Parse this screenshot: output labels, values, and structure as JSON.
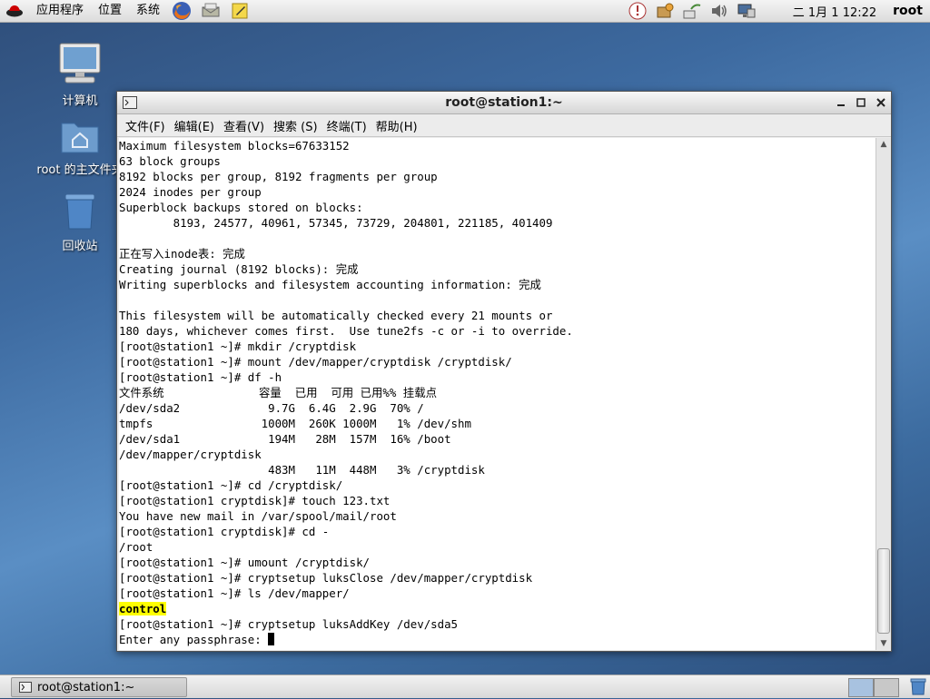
{
  "top_panel": {
    "menus": [
      "应用程序",
      "位置",
      "系统"
    ],
    "clock": "二 1月  1 12:22",
    "user": "root"
  },
  "desktop": {
    "icons": [
      {
        "label": "计算机",
        "icon": "computer-icon"
      },
      {
        "label": "root 的主文件夹",
        "icon": "home-folder-icon"
      },
      {
        "label": "回收站",
        "icon": "trash-icon"
      }
    ]
  },
  "window": {
    "title": "root@station1:~",
    "menus": [
      "文件(F)",
      "编辑(E)",
      "查看(V)",
      "搜索 (S)",
      "终端(T)",
      "帮助(H)"
    ],
    "terminal": {
      "lines_before": [
        "Maximum filesystem blocks=67633152",
        "63 block groups",
        "8192 blocks per group, 8192 fragments per group",
        "2024 inodes per group",
        "Superblock backups stored on blocks:",
        "        8193, 24577, 40961, 57345, 73729, 204801, 221185, 401409",
        "",
        "正在写入inode表: 完成",
        "Creating journal (8192 blocks): 完成",
        "Writing superblocks and filesystem accounting information: 完成",
        "",
        "This filesystem will be automatically checked every 21 mounts or",
        "180 days, whichever comes first.  Use tune2fs -c or -i to override.",
        "[root@station1 ~]# mkdir /cryptdisk",
        "[root@station1 ~]# mount /dev/mapper/cryptdisk /cryptdisk/",
        "[root@station1 ~]# df -h",
        "文件系统              容量  已用  可用 已用%% 挂载点",
        "/dev/sda2             9.7G  6.4G  2.9G  70% /",
        "tmpfs                1000M  260K 1000M   1% /dev/shm",
        "/dev/sda1             194M   28M  157M  16% /boot",
        "/dev/mapper/cryptdisk",
        "                      483M   11M  448M   3% /cryptdisk",
        "[root@station1 ~]# cd /cryptdisk/",
        "[root@station1 cryptdisk]# touch 123.txt",
        "You have new mail in /var/spool/mail/root",
        "[root@station1 cryptdisk]# cd -",
        "/root",
        "[root@station1 ~]# umount /cryptdisk/",
        "[root@station1 ~]# cryptsetup luksClose /dev/mapper/cryptdisk",
        "[root@station1 ~]# ls /dev/mapper/"
      ],
      "highlighted": "control",
      "lines_after": [
        "[root@station1 ~]# cryptsetup luksAddKey /dev/sda5"
      ],
      "prompt": "Enter any passphrase: "
    }
  },
  "taskbar": {
    "task_label": "root@station1:~"
  },
  "colors": {
    "highlight": "#ffff00",
    "desktop": "#3d6aa0"
  }
}
